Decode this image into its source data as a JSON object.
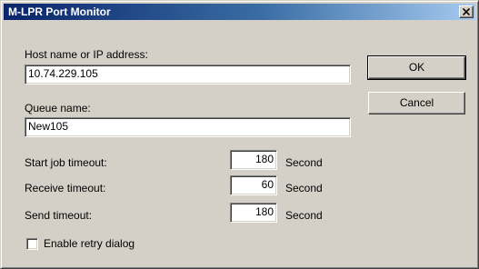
{
  "window": {
    "title": "M-LPR Port Monitor",
    "close_icon": "close-x-icon"
  },
  "form": {
    "host_label": "Host name or IP address:",
    "host_value": "10.74.229.105",
    "queue_label": "Queue name:",
    "queue_value": "New105",
    "start_job_label": "Start job timeout:",
    "start_job_value": "180",
    "start_job_unit": "Second",
    "receive_label": "Receive timeout:",
    "receive_value": "60",
    "receive_unit": "Second",
    "send_label": "Send timeout:",
    "send_value": "180",
    "send_unit": "Second",
    "retry_label": "Enable retry dialog",
    "retry_checked": false
  },
  "buttons": {
    "ok_label": "OK",
    "cancel_label": "Cancel"
  }
}
